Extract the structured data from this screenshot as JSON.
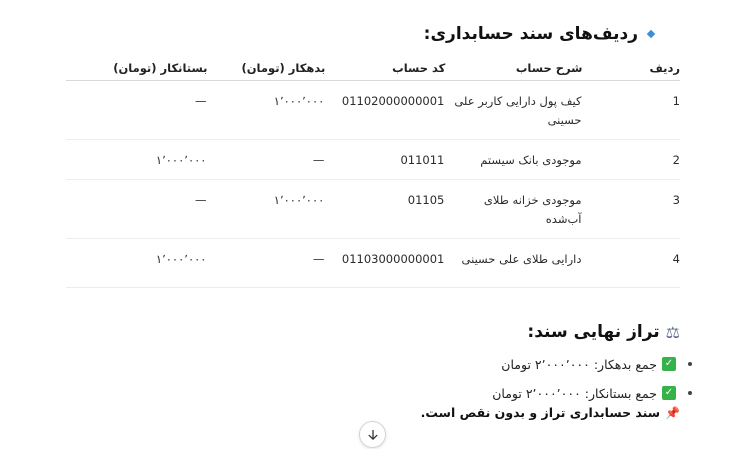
{
  "section": {
    "title": "ردیف‌های سند حسابداری:"
  },
  "table": {
    "headers": {
      "row": "ردیف",
      "description": "شرح حساب",
      "code": "کد حساب",
      "debit": "بدهکار (تومان)",
      "credit": "بستانکار (تومان)"
    },
    "rows": [
      {
        "row": "1",
        "description": "کیف پول دارایی کاربر علی حسینی",
        "code": "01102000000001",
        "debit": "۱٬۰۰۰٬۰۰۰",
        "credit": "—"
      },
      {
        "row": "2",
        "description": "موجودی بانک سیستم",
        "code": "011011",
        "debit": "—",
        "credit": "۱٬۰۰۰٬۰۰۰"
      },
      {
        "row": "3",
        "description": "موجودی خزانه طلای آب‌شده",
        "code": "01105",
        "debit": "۱٬۰۰۰٬۰۰۰",
        "credit": "—"
      },
      {
        "row": "4",
        "description": "دارایی طلای علی حسینی",
        "code": "01103000000001",
        "debit": "—",
        "credit": "۱٬۰۰۰٬۰۰۰"
      }
    ]
  },
  "balance": {
    "title": "تراز نهایی سند:",
    "items": [
      "جمع بدهکار: ۲٬۰۰۰٬۰۰۰ تومان",
      "جمع بستانکار: ۲٬۰۰۰٬۰۰۰ تومان"
    ],
    "note": "سند حسابداری تراز و بدون نقص است."
  },
  "icons": {
    "heading_marker": "blue-diamond-icon",
    "balance": "balance-scale-icon",
    "check": "check-mark-icon",
    "pin": "pushpin-icon",
    "scroll": "arrow-down-icon"
  },
  "colors": {
    "accent_blue": "#3a8fd9",
    "check_green": "#36b24a",
    "pin_red": "#d9343b"
  }
}
